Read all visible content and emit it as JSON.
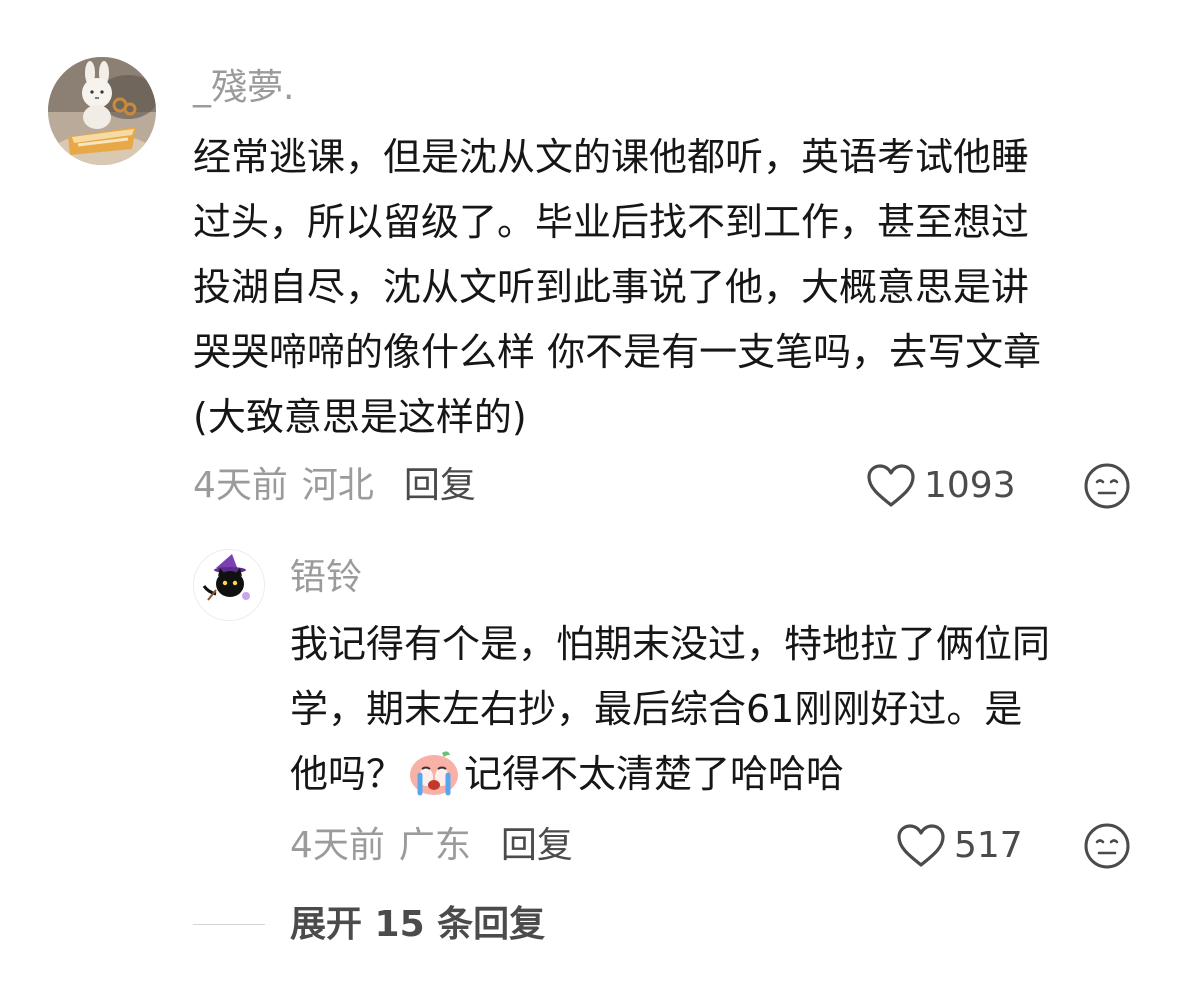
{
  "comment": {
    "username": "_殘夢.",
    "body_lines": [
      "经常逃课，但是沈从文的课他都听，英语考试他睡",
      "过头，所以留级了。毕业后找不到工作，甚至想过",
      "投湖自尽，沈从文听到此事说了他，大概意思是讲",
      "哭哭啼啼的像什么样 你不是有一支笔吗，去写文章",
      "(大致意思是这样的)"
    ],
    "time": "4天前",
    "region": "河北",
    "reply_label": "回复",
    "like_count": "1093",
    "like_icon": "heart-outline-icon",
    "dislike_icon": "unhappy-face-icon"
  },
  "reply": {
    "username": "铻铃",
    "body_lines": [
      "我记得有个是，怕期末没过，特地拉了俩位同",
      "学，期末左右抄，最后综合61刚刚好过。是"
    ],
    "body_line3_before": "他吗？",
    "body_line3_after": "记得不太清楚了哈哈哈",
    "emoji": "crying-face-emoji",
    "time": "4天前",
    "region": "广东",
    "reply_label": "回复",
    "like_count": "517",
    "like_icon": "heart-outline-icon",
    "dislike_icon": "unhappy-face-icon"
  },
  "expand": {
    "label": "展开 15 条回复"
  },
  "colors": {
    "text_primary": "#161616",
    "text_secondary": "#9b9b9b",
    "text_action": "#4b4b4b",
    "divider": "#d6d6d6"
  }
}
